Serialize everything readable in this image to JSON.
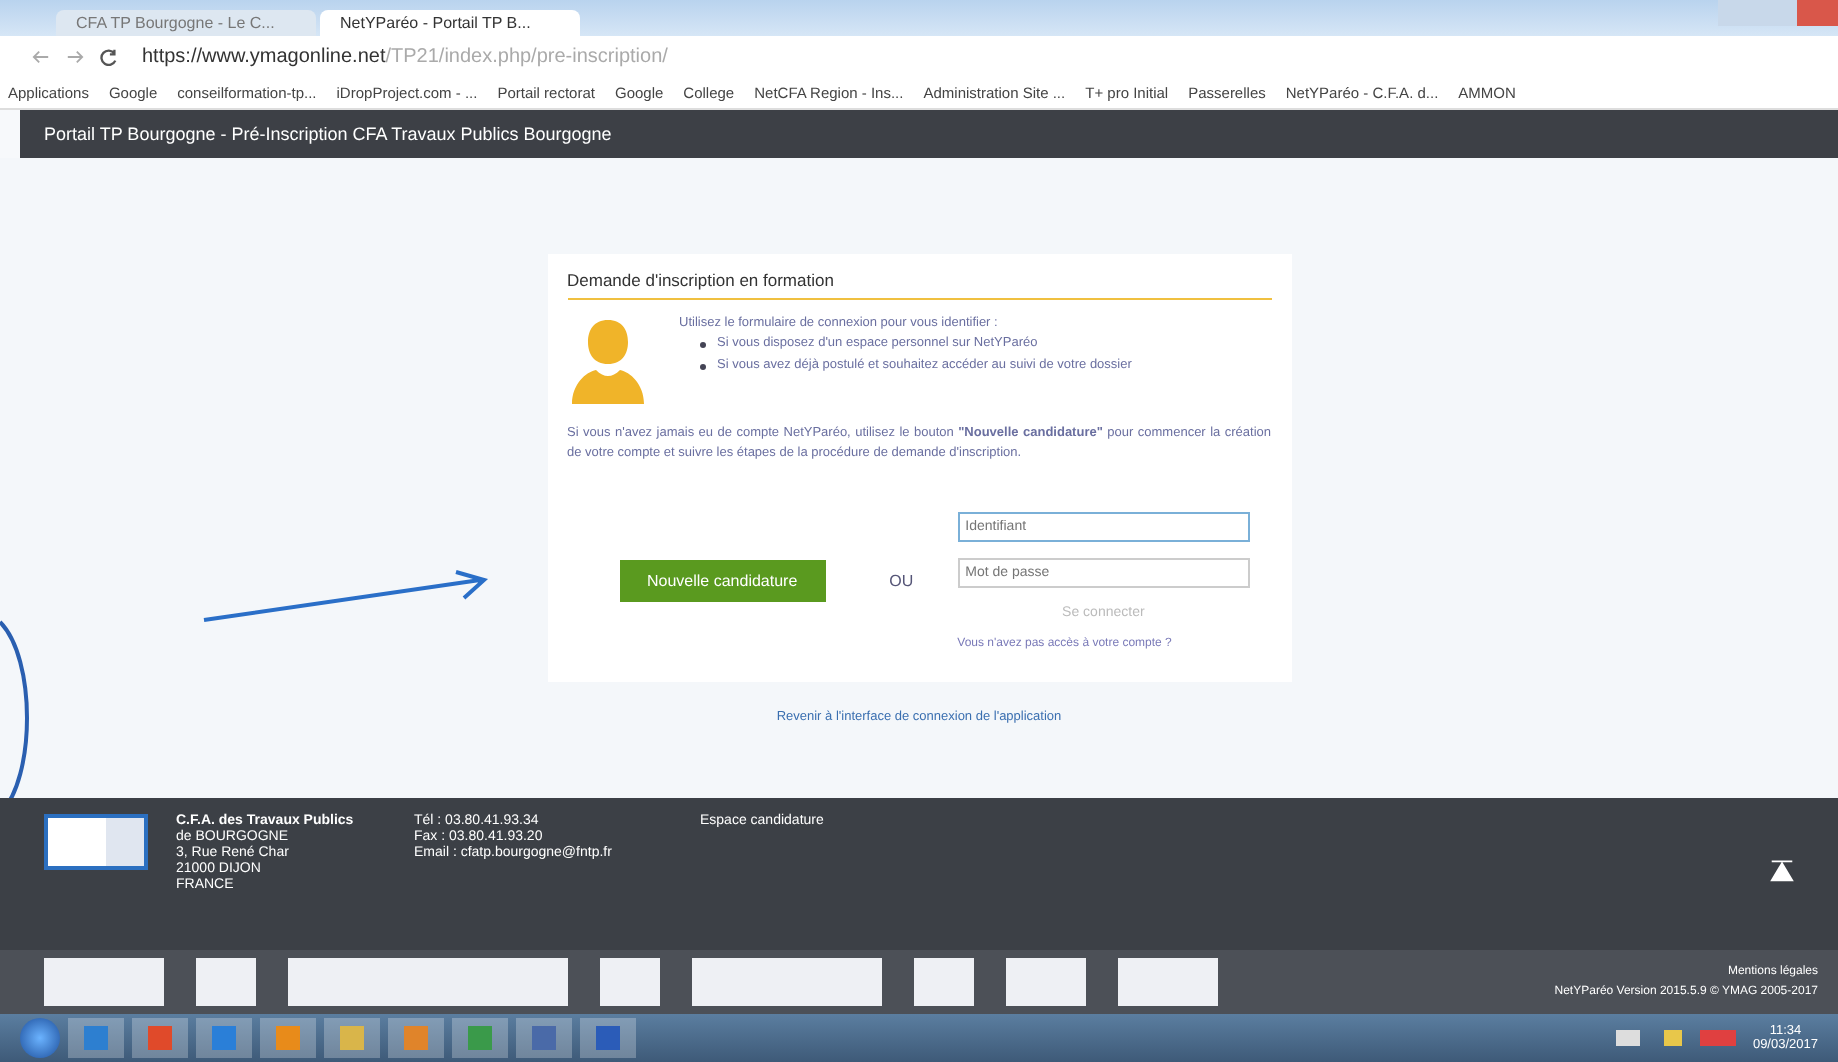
{
  "browser": {
    "tabs": [
      {
        "label": "CFA TP Bourgogne - Le C...",
        "selected": false
      },
      {
        "label": "NetYParéo - Portail TP B...",
        "selected": true
      }
    ],
    "url_host": "https://www.ymagonline.net",
    "url_path": "/TP21/index.php/pre-inscription/",
    "bookmarks": [
      "Applications",
      "Google",
      "conseilformation-tp...",
      "iDropProject.com - ...",
      "Portail rectorat",
      "Google",
      "College",
      "NetCFA Region - Ins...",
      "Administration Site ...",
      "T+ pro Initial",
      "Passerelles",
      "NetYParéo - C.F.A. d...",
      "AMMON"
    ]
  },
  "header": {
    "title": "Portail TP Bourgogne - Pré-Inscription CFA Travaux Publics Bourgogne"
  },
  "card": {
    "title": "Demande d'inscription en formation",
    "intro": "Utilisez le formulaire de connexion pour vous identifier :",
    "bullets": [
      "Si vous disposez d'un espace personnel sur NetYParéo",
      "Si vous avez déjà postulé et souhaitez accéder au suivi de votre dossier"
    ],
    "paragraph": "Si vous n'avez jamais eu de compte NetYParéo, utilisez le bouton **\"Nouvelle candidature\"** pour commencer la création de votre compte et suivre les étapes de la procédure de demande d'inscription.",
    "new_button": "Nouvelle candidature",
    "or": "OU",
    "login": {
      "placeholder": "Identifiant"
    },
    "password": {
      "placeholder": "Mot de passe"
    },
    "connect_button": "Se connecter",
    "forgot_link": "Vous n'avez pas accès à votre compte ?"
  },
  "back_link": "Revenir à l'interface de connexion de l'application",
  "footer": {
    "org": [
      "C.F.A. des Travaux Publics",
      "de BOURGOGNE",
      "3, Rue René Char",
      "21000 DIJON",
      "FRANCE"
    ],
    "contact": [
      "Tél : 03.80.41.93.34",
      "Fax : 03.80.41.93.20",
      "Email : cfatp.bourgogne@fntp.fr"
    ],
    "space": "Espace candidature",
    "legal": "Mentions légales",
    "version": "NetYParéo Version 2015.5.9 © YMAG 2005-2017"
  },
  "taskbar": {
    "time": "11:34",
    "date": "09/03/2017"
  }
}
